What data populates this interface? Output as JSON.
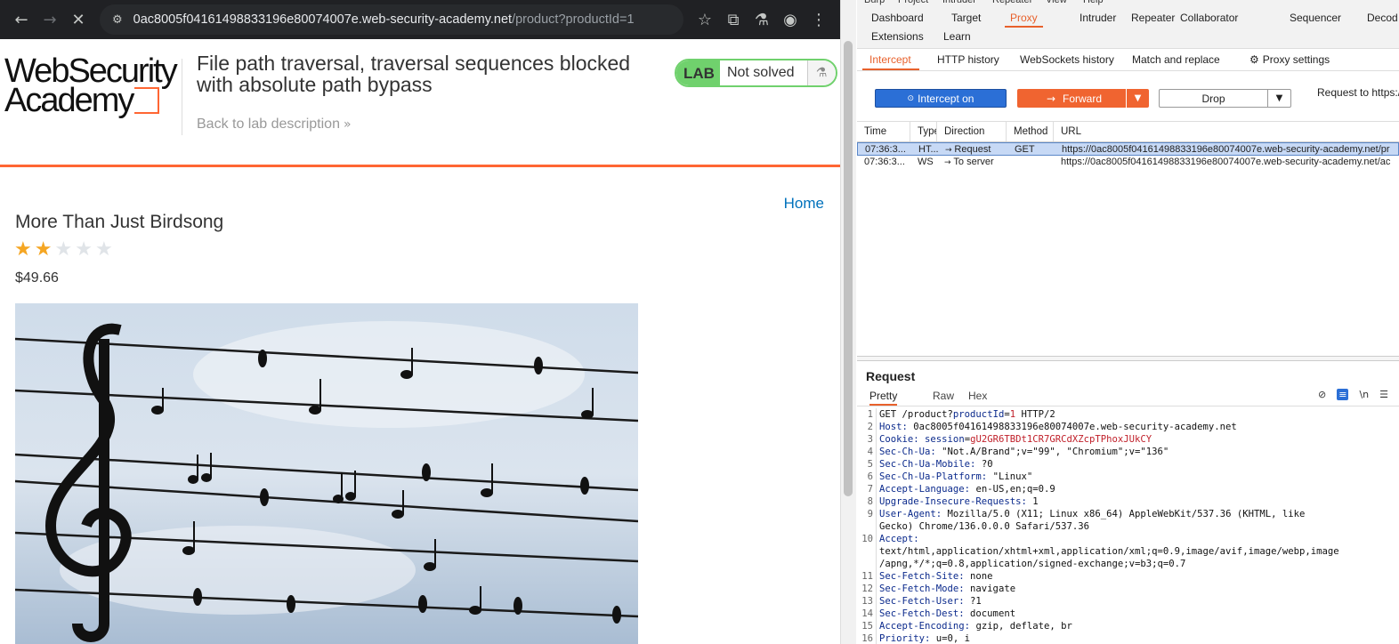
{
  "browser": {
    "url_host": "0ac8005f04161498833196e80074007e.web-security-academy.net",
    "url_path": "/product?productId=1"
  },
  "lab": {
    "logo_line1": "WebSecurity",
    "logo_line2": "Academy",
    "title": "File path traversal, traversal sequences blocked with absolute path bypass",
    "back_link": "Back to lab description",
    "badge_label": "LAB",
    "status": "Not solved"
  },
  "shop": {
    "home_link": "Home",
    "product_title": "More Than Just Birdsong",
    "rating": 2,
    "rating_max": 5,
    "price": "$49.66"
  },
  "burp": {
    "menu": [
      "Burp",
      "Project",
      "Intruder",
      "Repeater",
      "View",
      "Help"
    ],
    "top_tabs_row1": [
      "Dashboard",
      "Target",
      "Proxy",
      "Intruder",
      "Repeater",
      "Collaborator",
      "Sequencer",
      "Decod"
    ],
    "top_tabs_row2": [
      "Extensions",
      "Learn"
    ],
    "active_top_tab": "Proxy",
    "sub_tabs": [
      "Intercept",
      "HTTP history",
      "WebSockets history",
      "Match and replace",
      "Proxy settings"
    ],
    "active_sub_tab": "Intercept",
    "intercept_btn": "Intercept on",
    "forward_btn": "Forward",
    "drop_btn": "Drop",
    "request_to": "Request to https://",
    "columns": [
      "Time",
      "Type",
      "Direction",
      "Method",
      "URL"
    ],
    "rows": [
      {
        "time": "07:36:3...",
        "type": "HT...",
        "direction": "Request",
        "method": "GET",
        "url": "https://0ac8005f04161498833196e80074007e.web-security-academy.net/pr"
      },
      {
        "time": "07:36:3...",
        "type": "WS",
        "direction": "To server",
        "method": "",
        "url": "https://0ac8005f04161498833196e80074007e.web-security-academy.net/ac"
      }
    ],
    "request_header": "Request",
    "request_tabs": [
      "Pretty",
      "Raw",
      "Hex"
    ],
    "request_lines": [
      {
        "n": "1",
        "parts": [
          [
            "hv",
            "GET /product?"
          ],
          [
            "hk",
            "productId"
          ],
          [
            "hv",
            "="
          ],
          [
            "hred",
            "1"
          ],
          [
            "hv",
            " HTTP/2"
          ]
        ]
      },
      {
        "n": "2",
        "parts": [
          [
            "hk",
            "Host:"
          ],
          [
            "hv",
            " 0ac8005f04161498833196e80074007e.web-security-academy.net"
          ]
        ]
      },
      {
        "n": "3",
        "parts": [
          [
            "hk",
            "Cookie:"
          ],
          [
            "hv",
            " "
          ],
          [
            "hk",
            "session"
          ],
          [
            "hv",
            "="
          ],
          [
            "hred",
            "gU2GR6TBDt1CR7GRCdXZcpTPhoxJUkCY"
          ]
        ]
      },
      {
        "n": "4",
        "parts": [
          [
            "hk",
            "Sec-Ch-Ua:"
          ],
          [
            "hv",
            " \"Not.A/Brand\";v=\"99\", \"Chromium\";v=\"136\""
          ]
        ]
      },
      {
        "n": "5",
        "parts": [
          [
            "hk",
            "Sec-Ch-Ua-Mobile:"
          ],
          [
            "hv",
            " ?0"
          ]
        ]
      },
      {
        "n": "6",
        "parts": [
          [
            "hk",
            "Sec-Ch-Ua-Platform:"
          ],
          [
            "hv",
            " \"Linux\""
          ]
        ]
      },
      {
        "n": "7",
        "parts": [
          [
            "hk",
            "Accept-Language:"
          ],
          [
            "hv",
            " en-US,en;q=0.9"
          ]
        ]
      },
      {
        "n": "8",
        "parts": [
          [
            "hk",
            "Upgrade-Insecure-Requests:"
          ],
          [
            "hv",
            " 1"
          ]
        ]
      },
      {
        "n": "9",
        "parts": [
          [
            "hk",
            "User-Agent:"
          ],
          [
            "hv",
            " Mozilla/5.0 (X11; Linux x86_64) AppleWebKit/537.36 (KHTML, like"
          ]
        ]
      },
      {
        "n": "",
        "parts": [
          [
            "hv",
            "Gecko) Chrome/136.0.0.0 Safari/537.36"
          ]
        ]
      },
      {
        "n": "10",
        "parts": [
          [
            "hk",
            "Accept:"
          ]
        ]
      },
      {
        "n": "",
        "parts": [
          [
            "hv",
            "text/html,application/xhtml+xml,application/xml;q=0.9,image/avif,image/webp,image"
          ]
        ]
      },
      {
        "n": "",
        "parts": [
          [
            "hv",
            "/apng,*/*;q=0.8,application/signed-exchange;v=b3;q=0.7"
          ]
        ]
      },
      {
        "n": "11",
        "parts": [
          [
            "hk",
            "Sec-Fetch-Site:"
          ],
          [
            "hv",
            " none"
          ]
        ]
      },
      {
        "n": "12",
        "parts": [
          [
            "hk",
            "Sec-Fetch-Mode:"
          ],
          [
            "hv",
            " navigate"
          ]
        ]
      },
      {
        "n": "13",
        "parts": [
          [
            "hk",
            "Sec-Fetch-User:"
          ],
          [
            "hv",
            " ?1"
          ]
        ]
      },
      {
        "n": "14",
        "parts": [
          [
            "hk",
            "Sec-Fetch-Dest:"
          ],
          [
            "hv",
            " document"
          ]
        ]
      },
      {
        "n": "15",
        "parts": [
          [
            "hk",
            "Accept-Encoding:"
          ],
          [
            "hv",
            " gzip, deflate, br"
          ]
        ]
      },
      {
        "n": "16",
        "parts": [
          [
            "hk",
            "Priority:"
          ],
          [
            "hv",
            " u=0, i"
          ]
        ]
      }
    ]
  },
  "colors": {
    "burp_orange": "#e8612c",
    "wsa_orange": "#ff6633",
    "lab_green": "#70d16d",
    "link_blue": "#0071bc"
  }
}
